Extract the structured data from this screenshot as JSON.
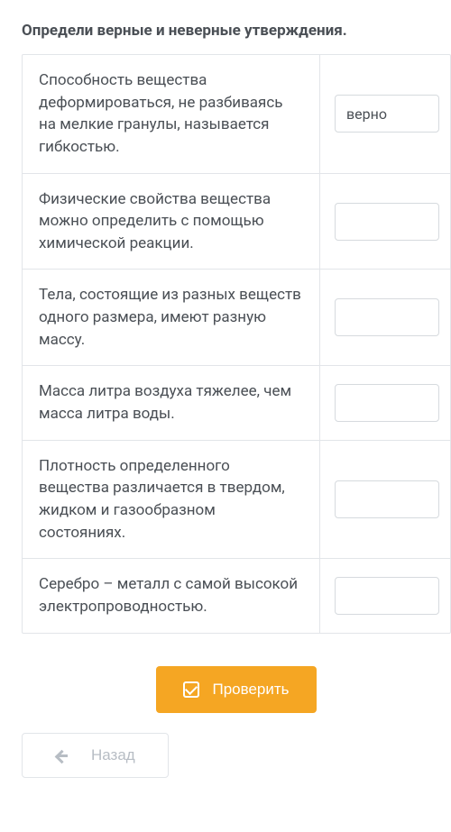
{
  "title": "Определи верные и неверные утверждения.",
  "rows": [
    {
      "statement": "Способность вещества деформироваться, не разбиваясь на мелкие гранулы, называется гибкостью.",
      "answer": "верно"
    },
    {
      "statement": "Физические свойства вещества можно определить с помощью химической реакции.",
      "answer": ""
    },
    {
      "statement": "Тела, состоящие из разных веществ одного размера, имеют разную массу.",
      "answer": ""
    },
    {
      "statement": "Масса литра воздуха тяжелее, чем масса литра воды.",
      "answer": ""
    },
    {
      "statement": "Плотность определенного вещества различается в твердом, жидком и газообразном состояниях.",
      "answer": ""
    },
    {
      "statement": "Серебро – металл с самой высокой электропроводностью.",
      "answer": ""
    }
  ],
  "buttons": {
    "check": "Проверить",
    "back": "Назад"
  }
}
